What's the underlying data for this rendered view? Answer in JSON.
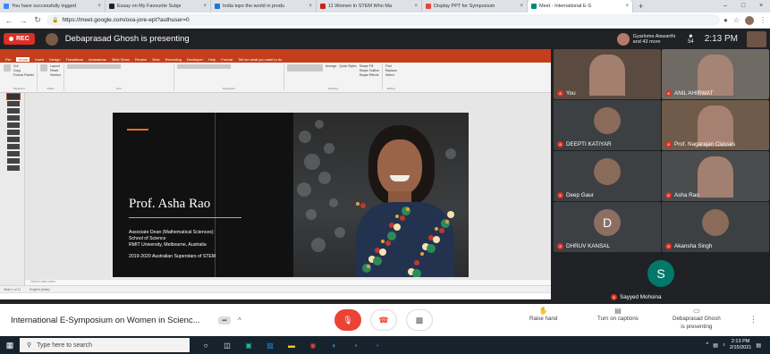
{
  "browser": {
    "tabs": [
      {
        "title": "You have successfully logged",
        "color": "#4285f4",
        "active": false
      },
      {
        "title": "Essay on My Favourite Subje",
        "color": "#202124",
        "active": false
      },
      {
        "title": "India tops the world in produ",
        "color": "#1a73e8",
        "active": false
      },
      {
        "title": "11 Women In STEM Who Ma",
        "color": "#c5221f",
        "active": false
      },
      {
        "title": "Display PPT for Symposium",
        "color": "#ea4335",
        "active": false
      },
      {
        "title": "Meet - International E-S",
        "color": "#00897b",
        "active": true
      }
    ],
    "url": "https://meet.google.com/oxa-jore-ept?authuser=0"
  },
  "meet": {
    "rec_label": "REC",
    "presenting_text": "Debaprasad Ghosh is presenting",
    "others_line1": "Gyarlome Aiswarthi",
    "others_line2": "and 43 more",
    "participant_count": "54",
    "time": "2:13  PM",
    "meeting_title": "International E-Symposium on Women in Scienc...",
    "controls": {
      "raise_hand": "Raise hand",
      "captions": "Turn on captions",
      "presenting_line1": "Debaprasad Ghosh",
      "presenting_line2": "is presenting"
    }
  },
  "ppt": {
    "tabs": [
      "File",
      "Home",
      "Insert",
      "Design",
      "Transitions",
      "Animations",
      "Slide Show",
      "Review",
      "View",
      "Recording",
      "Developer",
      "Help",
      "Format",
      "Tell me what you want to do"
    ],
    "clipboard": [
      "Cut",
      "Copy",
      "Format Painter"
    ],
    "slides_group": [
      "New Slide",
      "Layout",
      "Reset",
      "Section"
    ],
    "groups": [
      "Clipboard",
      "Slides",
      "Font",
      "Paragraph",
      "Drawing",
      "Editing"
    ],
    "drawing": [
      "Shape Fill",
      "Shape Outline",
      "Shape Effects",
      "Arrange",
      "Quick Styles"
    ],
    "editing": [
      "Find",
      "Replace",
      "Select"
    ],
    "notes_placeholder": "Click to add notes",
    "status_left": "Slide 1 of 11",
    "status_lang": "English (India)",
    "slide": {
      "name": "Prof. Asha Rao",
      "line1": "Associate Dean (Mathematical Sciences)",
      "line2": "School of Science",
      "line3": "RMIT University, Melbourne, Australia",
      "line4": "2019-2020 Australian Superstars of STEM"
    }
  },
  "participants": [
    {
      "name": "You",
      "letter": "",
      "bg": "#5a4a40"
    },
    {
      "name": "ANIL AHIRWAT",
      "letter": "",
      "bg": "#6f6a63"
    },
    {
      "name": "DEEPTI KATIYAR",
      "letter": "",
      "bg": "#3c4043"
    },
    {
      "name": "Prof. Nagarajan Classes",
      "letter": "",
      "bg": "#6e5b4a"
    },
    {
      "name": "Deep Gaur",
      "letter": "",
      "bg": "#3c4043"
    },
    {
      "name": "Asha Rao",
      "letter": "",
      "bg": "#4a4c4e"
    },
    {
      "name": "DHRUV KANSAL",
      "letter": "D",
      "bg": "#3c4043"
    },
    {
      "name": "Akansha Singh",
      "letter": "",
      "bg": "#3c4043"
    },
    {
      "name": "Sayyed Mohsina",
      "letter": "S",
      "bg": "#202124"
    }
  ],
  "taskbar": {
    "search_placeholder": "Type here to search",
    "time": "2:13 PM",
    "date": "2/15/2021"
  }
}
